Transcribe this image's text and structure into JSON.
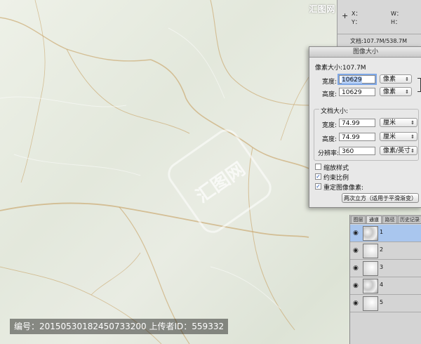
{
  "watermark": {
    "site": "汇图网 www.huitu.com",
    "center_mark": "汇图网"
  },
  "caption": "编号：20150530182450733200 上传者ID：559332",
  "info_panel": {
    "plus_glyph": "+",
    "x_label": "X：",
    "y_label": "Y：",
    "w_label": "W：",
    "h_label": "H：",
    "doc_size": "文档:107.7M/538.7M"
  },
  "dialog": {
    "title": "图像大小",
    "pixel_dimensions": "像素大小:107.7M",
    "width_label": "宽度:",
    "width_value": "10629",
    "height_label": "高度:",
    "height_value": "10629",
    "pixel_unit": "像素",
    "document_size": "文档大小:",
    "doc_width_label": "宽度:",
    "doc_width_value": "74.99",
    "doc_height_label": "高度:",
    "doc_height_value": "74.99",
    "cm_unit": "厘米",
    "resolution_label": "分辨率:",
    "resolution_value": "360",
    "resolution_unit": "像素/英寸",
    "scale_styles": {
      "label": "缩放样式",
      "checked": false
    },
    "constrain": {
      "label": "约束比例",
      "checked": true
    },
    "resample": {
      "label": "重定图像像素:",
      "checked": true
    },
    "resample_method": "两次立方（适用于平滑渐变）"
  },
  "channels_panel": {
    "tabs": [
      "图层",
      "通道",
      "路径",
      "历史记录"
    ],
    "active_tab": 1,
    "channels": [
      {
        "label": "1",
        "selected": true
      },
      {
        "label": "2",
        "selected": false
      },
      {
        "label": "3",
        "selected": false
      },
      {
        "label": "4",
        "selected": false
      },
      {
        "label": "5",
        "selected": false
      }
    ]
  },
  "colors": {
    "selection": "#a9c6ee",
    "marble_vein": "#c9a66b"
  }
}
